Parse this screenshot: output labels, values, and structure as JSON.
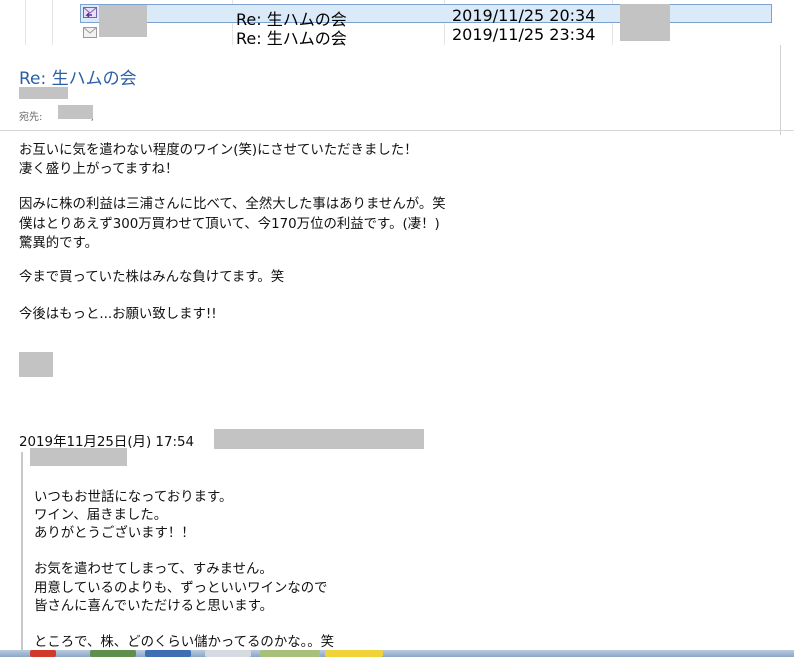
{
  "message_list": {
    "rows": [
      {
        "subject": "Re: 生ハムの会",
        "date": "2019/11/25 20:34",
        "selected": true
      },
      {
        "subject": "Re: 生ハムの会",
        "date": "2019/11/25 23:34",
        "selected": false
      }
    ]
  },
  "reading_pane": {
    "subject": "Re: 生ハムの会",
    "to_label": "宛先:",
    "to_value_suffix": ";",
    "body_lines": [
      "お互いに気を遣わない程度のワイン(笑)にさせていただきました！",
      "凄く盛り上がってますね！",
      "因みに株の利益は三浦さんに比べて、全然大した事はありませんが。笑",
      "僕はとりあえず300万買わせて頂いて、今170万位の利益です。(凄！)",
      "驚異的です。",
      "今まで買っていた株はみんな負けてます。笑",
      "今後はもっと...お願い致します!!"
    ],
    "quote_header": "2019年11月25日(月) 17:54",
    "quoted_lines": [
      "いつもお世話になっております。",
      "ワイン、届きました。",
      "ありがとうございます！！",
      "お気を遣わせてしまって、すみません。",
      "用意しているのよりも、ずっといいワインなので",
      "皆さんに喜んでいただけると思います。",
      "ところで、株、どのくらい儲かってるのかな。。笑"
    ]
  },
  "colors": {
    "subject_blue": "#2a5fa6",
    "selection_bg": "#dbeaf9",
    "selection_border": "#7da2ce",
    "redaction_gray": "#c3c3c3"
  },
  "icons": {
    "row1": "reply-mail-icon",
    "row2": "envelope-icon"
  }
}
